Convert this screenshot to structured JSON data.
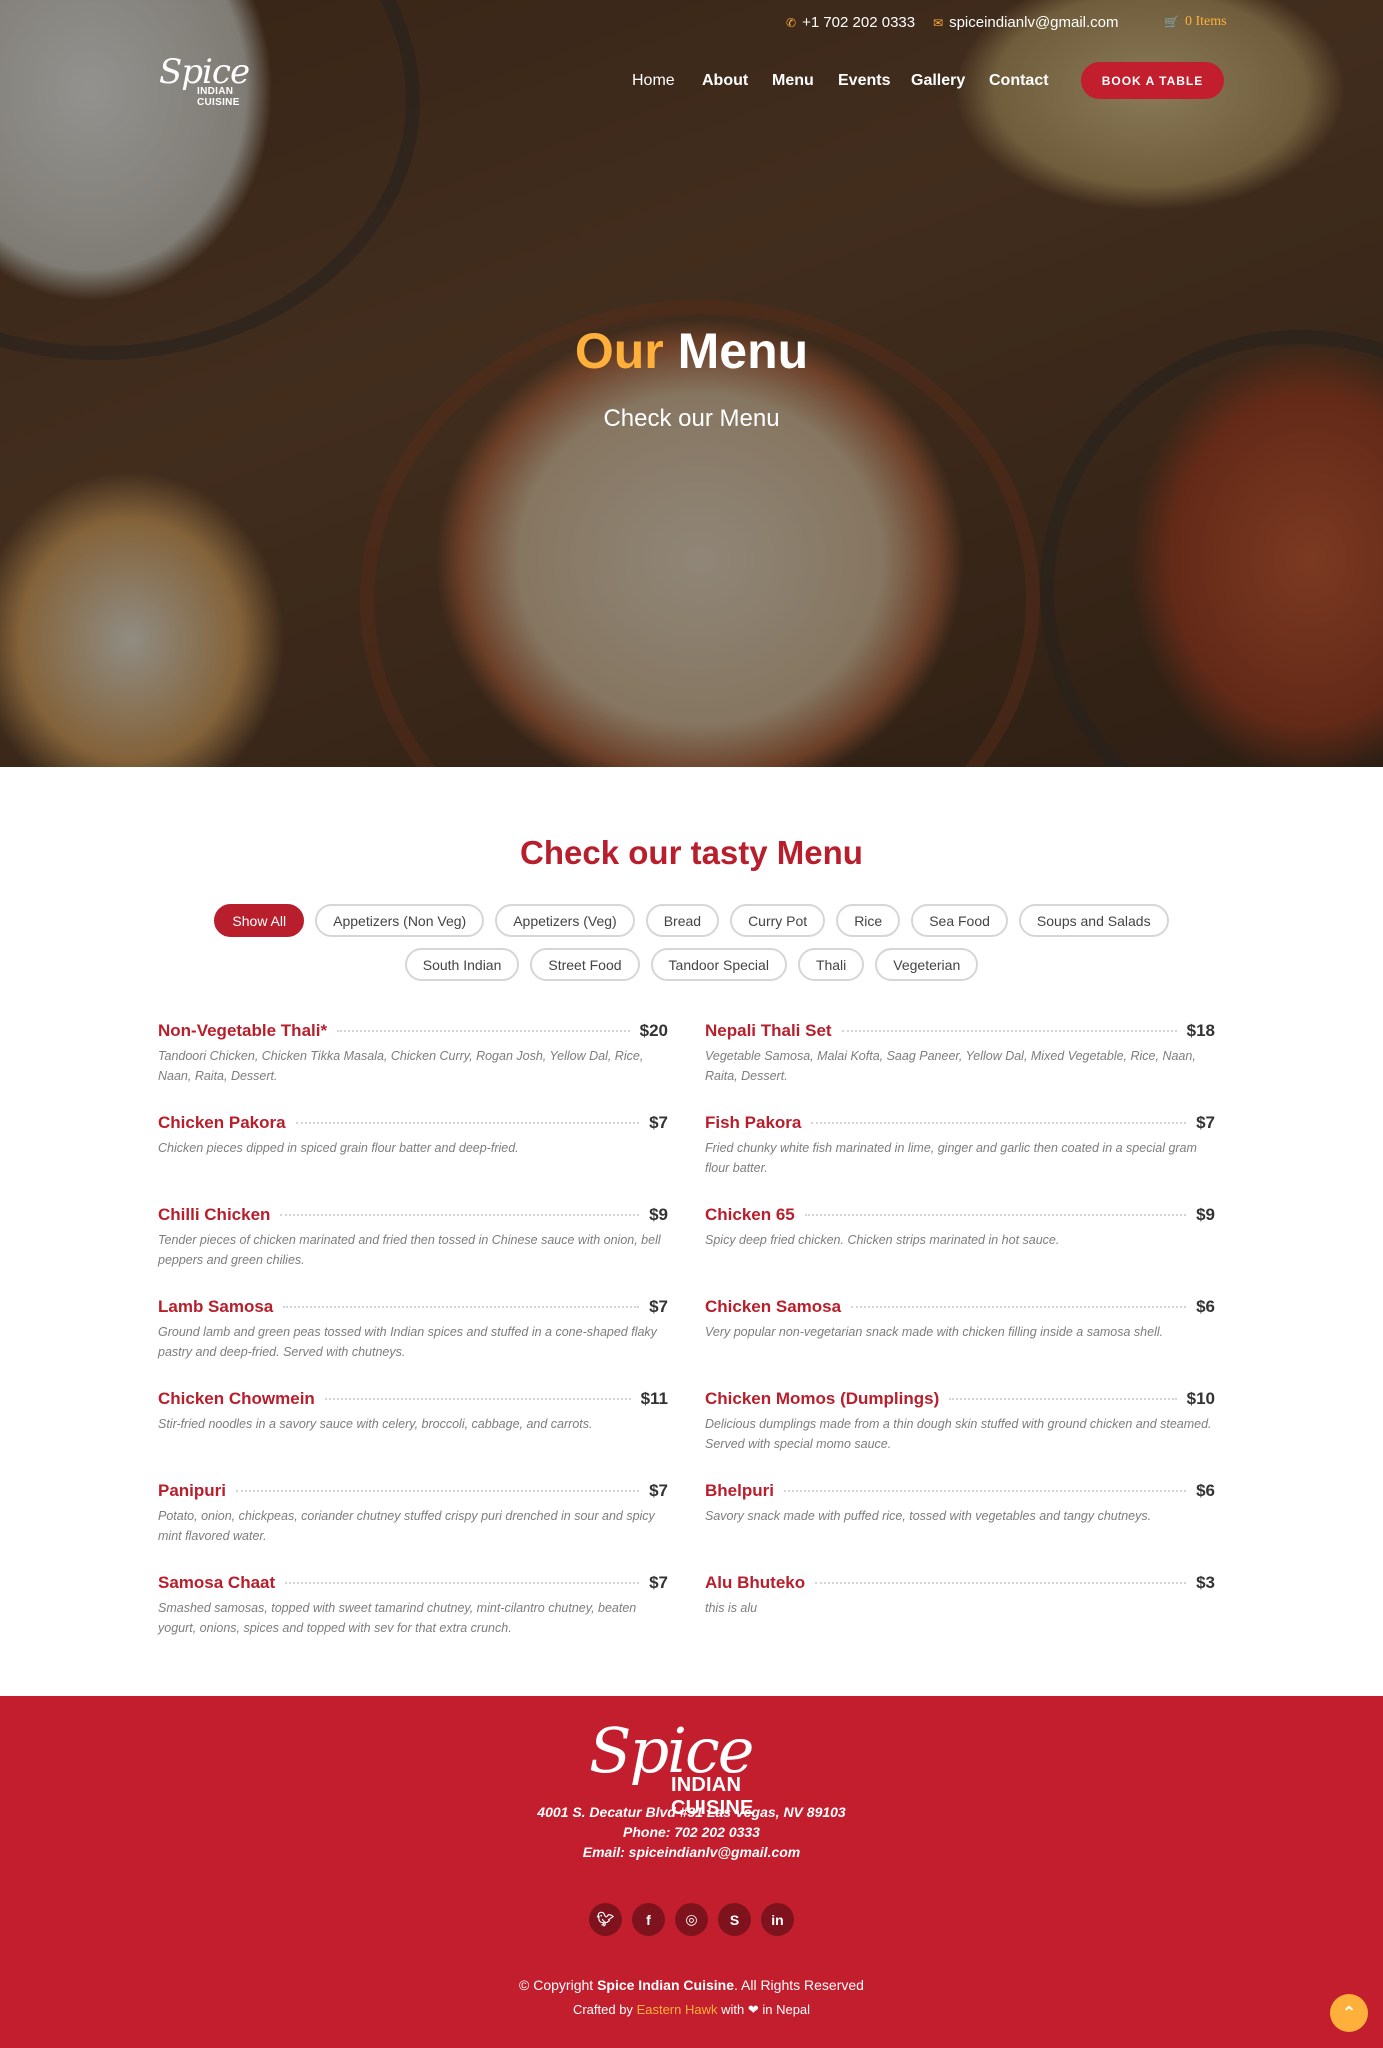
{
  "topbar": {
    "phone": "+1 702 202 0333",
    "email": "spiceindianlv@gmail.com",
    "cart": "0 Items"
  },
  "logo": {
    "script": "Spice",
    "sub": "INDIAN CUISINE"
  },
  "nav": {
    "items": [
      "Home",
      "About",
      "Menu",
      "Events",
      "Gallery",
      "Contact"
    ],
    "active": "Home",
    "book_label": "BOOK A TABLE"
  },
  "hero": {
    "title_accent": "Our",
    "title_rest": "Menu",
    "subtitle": "Check our Menu"
  },
  "menu": {
    "heading": "Check our tasty Menu",
    "filters_row1": [
      "Show All",
      "Appetizers (Non Veg)",
      "Appetizers (Veg)",
      "Bread",
      "Curry Pot",
      "Rice",
      "Sea Food",
      "Soups and Salads"
    ],
    "filters_row2": [
      "South Indian",
      "Street Food",
      "Tandoor Special",
      "Thali",
      "Vegeterian"
    ],
    "active_filter": "Show All",
    "items": [
      {
        "name": "Non-Vegetable Thali*",
        "price": "$20",
        "desc": "Tandoori Chicken, Chicken Tikka Masala, Chicken Curry, Rogan Josh, Yellow Dal, Rice, Naan, Raita, Dessert."
      },
      {
        "name": "Nepali Thali Set",
        "price": "$18",
        "desc": "Vegetable Samosa, Malai Kofta, Saag Paneer, Yellow Dal, Mixed Vegetable, Rice, Naan, Raita, Dessert."
      },
      {
        "name": "Chicken Pakora",
        "price": "$7",
        "desc": "Chicken pieces dipped in spiced grain flour batter and deep-fried."
      },
      {
        "name": "Fish Pakora",
        "price": "$7",
        "desc": "Fried chunky white fish marinated in lime, ginger and garlic then coated in a special gram flour batter."
      },
      {
        "name": "Chilli Chicken",
        "price": "$9",
        "desc": "Tender pieces of chicken marinated and fried then tossed in Chinese sauce with onion, bell peppers and green chilies."
      },
      {
        "name": "Chicken 65",
        "price": "$9",
        "desc": "Spicy deep fried chicken. Chicken strips marinated in hot sauce."
      },
      {
        "name": "Lamb Samosa",
        "price": "$7",
        "desc": "Ground lamb and green peas tossed with Indian spices and stuffed in a cone-shaped flaky pastry and deep-fried. Served with chutneys."
      },
      {
        "name": "Chicken Samosa",
        "price": "$6",
        "desc": "Very popular non-vegetarian snack made with chicken filling inside a samosa shell."
      },
      {
        "name": "Chicken Chowmein",
        "price": "$11",
        "desc": "Stir-fried noodles in a savory sauce with celery, broccoli, cabbage, and carrots."
      },
      {
        "name": "Chicken Momos (Dumplings)",
        "price": "$10",
        "desc": "Delicious dumplings made from a thin dough skin stuffed with ground chicken and steamed. Served with special momo sauce."
      },
      {
        "name": "Panipuri",
        "price": "$7",
        "desc": "Potato, onion, chickpeas, coriander chutney stuffed crispy puri drenched in sour and spicy mint flavored water."
      },
      {
        "name": "Bhelpuri",
        "price": "$6",
        "desc": "Savory snack made with puffed rice, tossed with vegetables and tangy chutneys."
      },
      {
        "name": "Samosa Chaat",
        "price": "$7",
        "desc": "Smashed samosas, topped with sweet tamarind chutney, mint-cilantro chutney, beaten yogurt, onions, spices and topped with sev for that extra crunch."
      },
      {
        "name": "Alu Bhuteko",
        "price": "$3",
        "desc": "this is alu"
      }
    ]
  },
  "footer": {
    "logo_script": "Spice",
    "logo_sub": "INDIAN CUISINE",
    "address": "4001 S. Decatur Blvd #31 Las Vegas, NV 89103",
    "phone": "Phone: 702 202 0333",
    "email": "Email: spiceindianlv@gmail.com",
    "socials": [
      "twitter-icon",
      "facebook-icon",
      "instagram-icon",
      "skype-icon",
      "linkedin-icon"
    ],
    "copy_prefix": "© Copyright",
    "copy_brand": "Spice Indian Cuisine",
    "copy_suffix": ". All Rights Reserved",
    "crafted_prefix": "Crafted by",
    "crafted_brand": "Eastern Hawk",
    "crafted_suffix": "with ❤ in Nepal"
  },
  "colors": {
    "brand_red": "#c21e2d",
    "accent_yellow": "#ffb03b"
  }
}
